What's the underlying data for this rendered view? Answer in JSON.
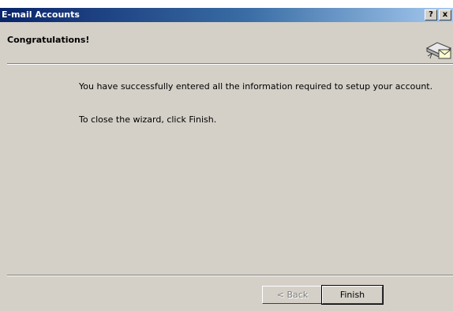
{
  "window": {
    "title": "E-mail Accounts",
    "help_button": "?",
    "close_button": "x"
  },
  "header": {
    "title": "Congratulations!",
    "icon": "email-envelope-icon"
  },
  "body": {
    "line1": "You have successfully entered all the information required to setup your account.",
    "line2": "To close the wizard, click Finish."
  },
  "buttons": {
    "back": "< Back",
    "finish": "Finish"
  },
  "colors": {
    "titlebar_start": "#0a246a",
    "titlebar_end": "#a6caf0",
    "dialog_bg": "#d4d0c8"
  }
}
